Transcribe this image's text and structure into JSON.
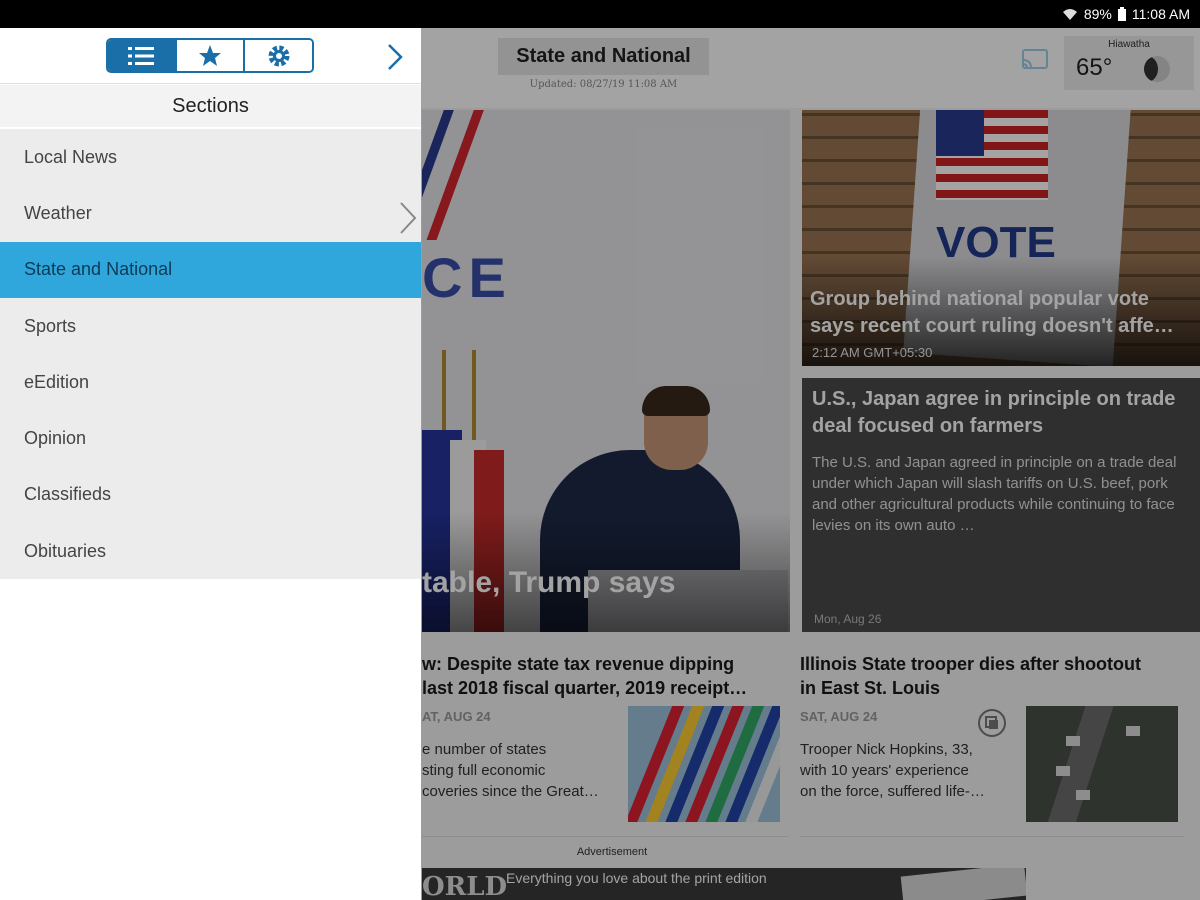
{
  "status_bar": {
    "battery": "89%",
    "time": "11:08 AM"
  },
  "header": {
    "section_title": "State and National",
    "updated": "Updated: 08/27/19 11:08 AM",
    "weather": {
      "location": "Hiawatha",
      "temperature": "65°"
    }
  },
  "stories": {
    "hero": {
      "headline_visible": "table, Trump says"
    },
    "vote": {
      "headline": "Group behind national popular vote says recent court ruling doesn't affe…",
      "time": "2:12 AM GMT+05:30"
    },
    "japan": {
      "headline": "U.S., Japan agree in principle on trade deal focused on farmers",
      "summary": "The U.S. and Japan agreed in principle on a trade deal under which Japan will slash tariffs on U.S. beef, pork and other agricultural products while continuing to face levies on its own auto …",
      "date": "Mon, Aug 26"
    },
    "tax": {
      "headline_line1": "w: Despite state tax revenue dipping",
      "headline_line2": "last 2018 fiscal quarter, 2019 receipt…",
      "date": "AT, AUG 24",
      "summary_line1": "e number of states",
      "summary_line2": "sting full economic",
      "summary_line3": "coveries since the Great…"
    },
    "trooper": {
      "headline_line1": "Illinois State trooper dies after shootout",
      "headline_line2": "in East St. Louis",
      "date": "SAT, AUG 24",
      "summary_line1": "Trooper Nick Hopkins, 33,",
      "summary_line2": "with 10 years' experience",
      "summary_line3": "on the force, suffered life-…"
    }
  },
  "ad": {
    "label": "Advertisement",
    "brand": "ORLD",
    "text": "Everything you love about the print edition"
  },
  "drawer": {
    "tabs": [
      "sections-list-icon",
      "favorites-star-icon",
      "settings-gear-icon"
    ],
    "sections_title": "Sections",
    "items": [
      {
        "label": "Local News"
      },
      {
        "label": "Weather"
      },
      {
        "label": "State and National",
        "selected": true
      },
      {
        "label": "Sports"
      },
      {
        "label": "eEdition"
      },
      {
        "label": "Opinion"
      },
      {
        "label": "Classifieds"
      },
      {
        "label": "Obituaries"
      }
    ]
  },
  "colors": {
    "accent": "#1a6fa8",
    "selected_row": "#2fa7dd"
  }
}
